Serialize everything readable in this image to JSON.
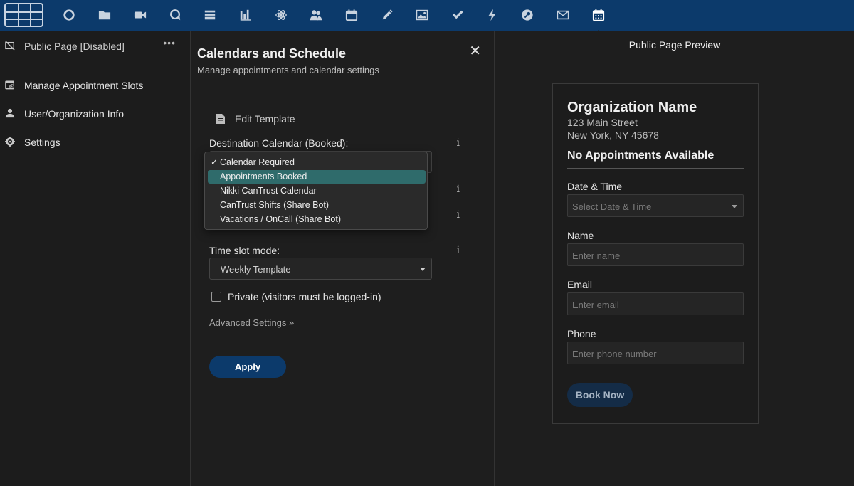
{
  "toolbar": {
    "icons": [
      "grid-logo-icon",
      "circle-icon",
      "folder-icon",
      "video-icon",
      "chat-bubble-icon",
      "stack-icon",
      "bar-chart-icon",
      "atom-icon",
      "users-icon",
      "calendar-icon",
      "pencil-icon",
      "image-icon",
      "checkmark-icon",
      "lightning-icon",
      "wrench-icon",
      "mail-icon",
      "calendar-grid-icon"
    ],
    "active": "calendar-grid-icon"
  },
  "sidebar": {
    "public_page": "Public Page [Disabled]",
    "more": "•••",
    "items": [
      {
        "label": "Manage Appointment Slots",
        "icon": "calendar-clock-icon"
      },
      {
        "label": "User/Organization Info",
        "icon": "user-icon"
      },
      {
        "label": "Settings",
        "icon": "gear-icon"
      }
    ]
  },
  "panel": {
    "title": "Calendars and Schedule",
    "subtitle": "Manage appointments and calendar settings",
    "close": "✕",
    "edit_template": "Edit Template",
    "destination_label": "Destination Calendar (Booked):",
    "info": "i",
    "dropdown": {
      "options": [
        {
          "label": "Calendar Required",
          "checked": true
        },
        {
          "label": "Appointments Booked",
          "highlighted": true
        },
        {
          "label": "Nikki CanTrust Calendar"
        },
        {
          "label": "CanTrust Shifts (Share Bot)"
        },
        {
          "label": "Vacations / OnCall (Share Bot)"
        }
      ],
      "check_mark": "✓"
    },
    "timeslot_label": "Time slot mode:",
    "timeslot_value": "Weekly Template",
    "private_label": "Private (visitors must be logged-in)",
    "private_checked": false,
    "advanced": "Advanced Settings »",
    "apply": "Apply"
  },
  "preview": {
    "header": "Public Page Preview",
    "org_name": "Organization Name",
    "street": "123 Main Street",
    "city": "New York, NY 45678",
    "no_appointments": "No Appointments Available",
    "date_label": "Date & Time",
    "date_placeholder": "Select Date & Time",
    "name_label": "Name",
    "name_placeholder": "Enter name",
    "email_label": "Email",
    "email_placeholder": "Enter email",
    "phone_label": "Phone",
    "phone_placeholder": "Enter phone number",
    "book_button": "Book Now"
  },
  "colors": {
    "topbar": "#0c3a6b",
    "background": "#1e1e1e",
    "highlight": "#2f6b6b",
    "apply_button": "#0c3a6b"
  }
}
